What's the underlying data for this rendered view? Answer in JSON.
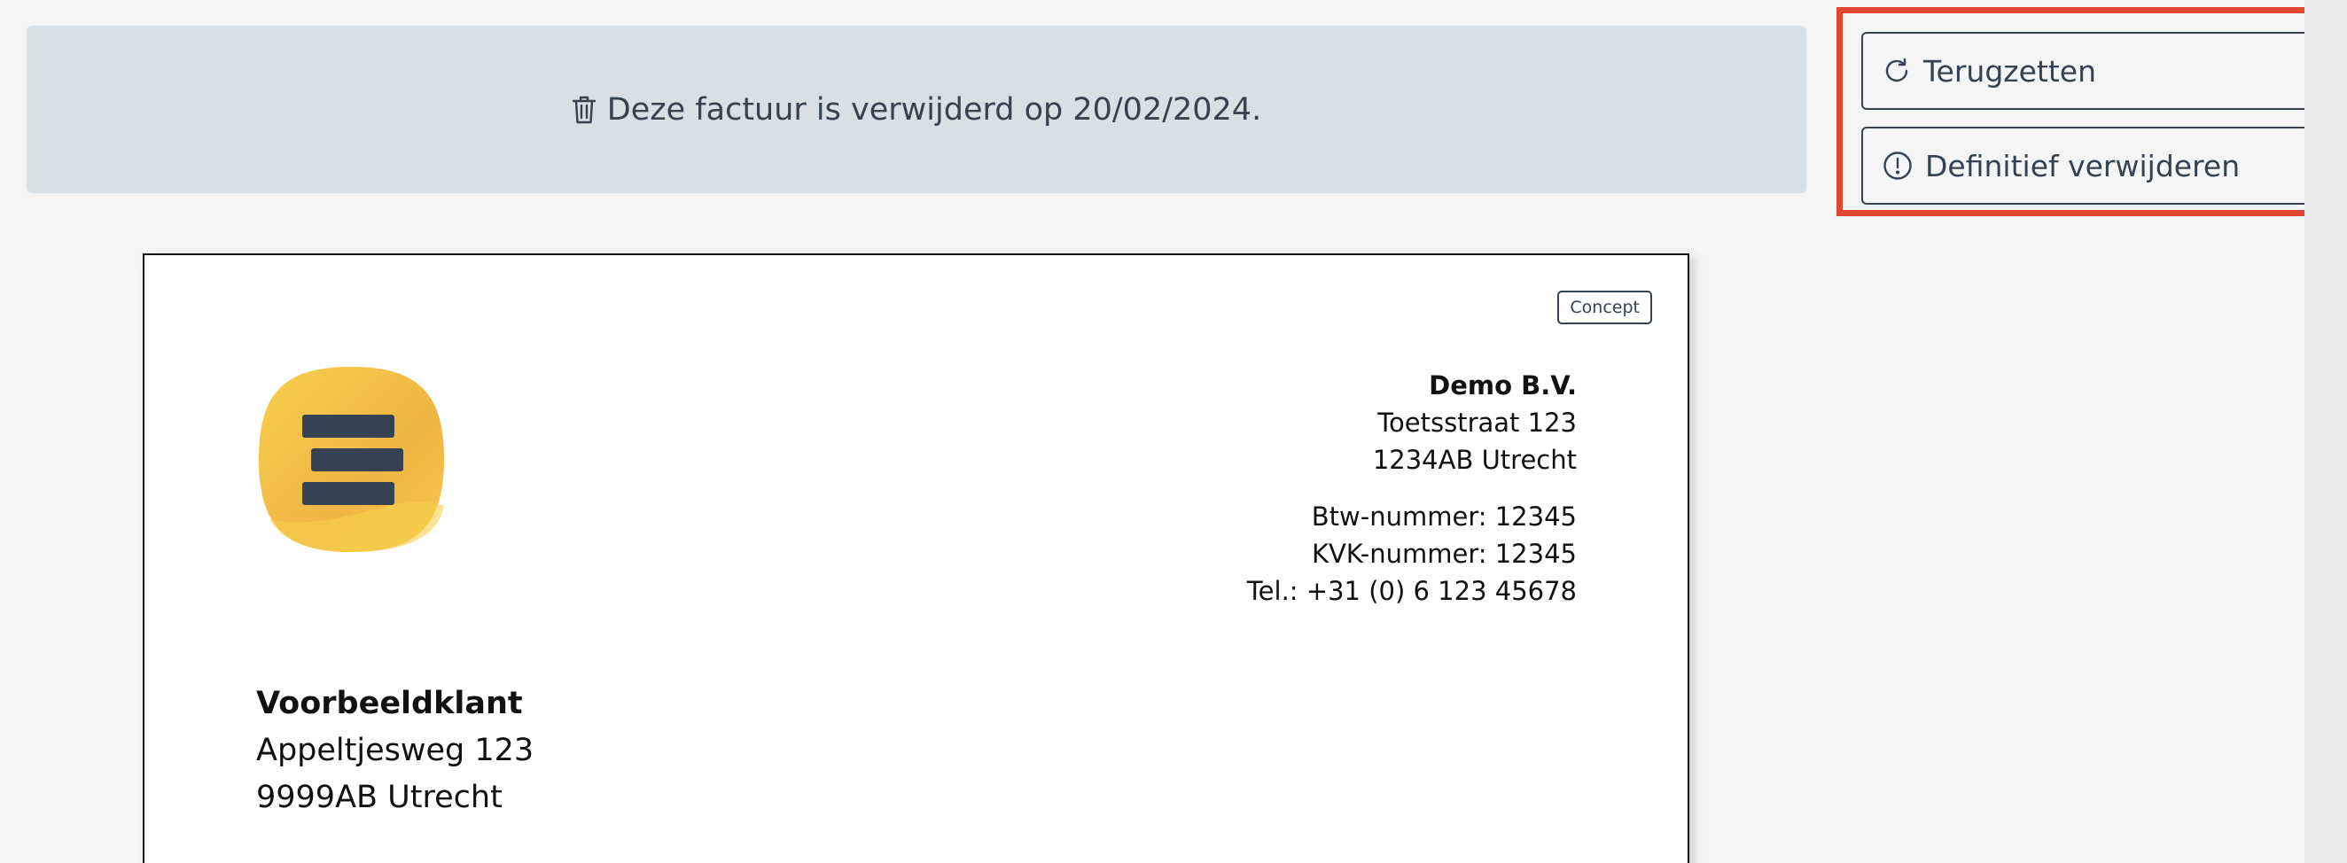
{
  "banner": {
    "text": "Deze factuur is verwijderd op 20/02/2024.",
    "icon": "trash-icon"
  },
  "actions": {
    "restore_label": "Terugzetten",
    "restore_icon": "refresh-icon",
    "delete_label": "Definitief verwijderen",
    "delete_icon": "alert-circle-icon"
  },
  "invoice": {
    "status_badge": "Concept",
    "company": {
      "name": "Demo B.V.",
      "street": "Toetsstraat 123",
      "city": "1234AB Utrecht",
      "vat": "Btw-nummer: 12345",
      "kvk": "KVK-nummer: 12345",
      "phone": "Tel.: +31 (0) 6 123 45678"
    },
    "client": {
      "name": "Voorbeeldklant",
      "street": "Appeltjesweg 123",
      "city": "9999AB Utrecht"
    }
  },
  "colors": {
    "banner_bg": "#d8dfe5",
    "text": "#354252",
    "highlight": "#e1452f",
    "logo_yellow": "#f5c242"
  }
}
